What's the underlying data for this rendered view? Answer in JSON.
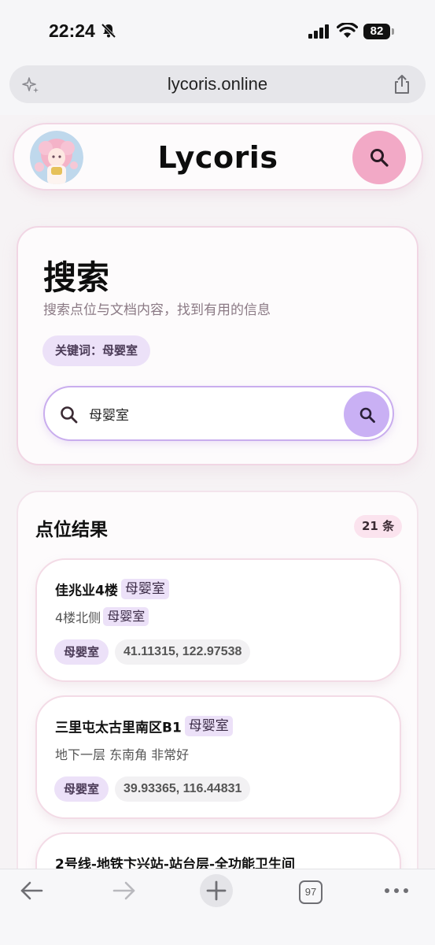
{
  "status_bar": {
    "time": "22:24",
    "battery": "82"
  },
  "browser": {
    "url": "lycoris.online",
    "tab_count": "97"
  },
  "header": {
    "logo": "Lycoris"
  },
  "search": {
    "title": "搜索",
    "subtitle": "搜索点位与文档内容，找到有用的信息",
    "keyword_chip": "关键词：母婴室",
    "query": "母婴室"
  },
  "results": {
    "title": "点位结果",
    "count": "21 条",
    "items": [
      {
        "title": "佳兆业4楼",
        "title_highlight": "母婴室",
        "desc": "4楼北侧",
        "desc_highlight": "母婴室",
        "tag": "母婴室",
        "coords": "41.11315, 122.97538"
      },
      {
        "title": "三里屯太古里南区B1",
        "title_highlight": "母婴室",
        "desc": "地下一层 东南角 非常好",
        "desc_highlight": "",
        "tag": "母婴室",
        "coords": "39.93365, 116.44831"
      },
      {
        "title": "2号线-地铁卞兴站-站台层-全功能卫生间",
        "title_highlight": "",
        "desc": "",
        "desc_highlight": "",
        "tag": "",
        "coords": ""
      }
    ]
  },
  "colors": {
    "pink_accent": "#f2a9c6",
    "lavender_accent": "#c9b0f4",
    "chip_bg": "#ece1f8"
  },
  "icons": [
    "bell-slash-icon",
    "signal-icon",
    "wifi-icon",
    "sparkle-icon",
    "share-icon",
    "search-icon",
    "back-arrow-icon",
    "forward-arrow-icon",
    "plus-icon",
    "tabs-icon",
    "more-icon"
  ]
}
